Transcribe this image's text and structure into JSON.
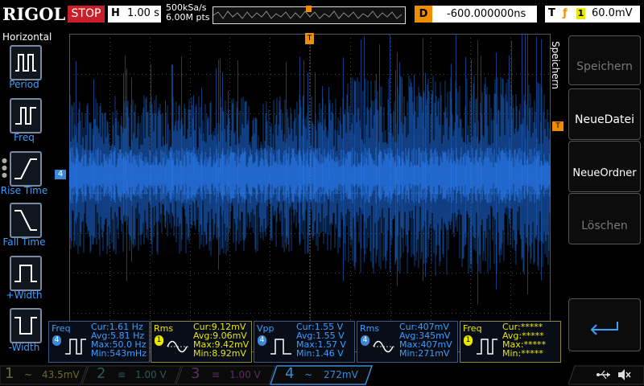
{
  "brand": "RIGOL",
  "run_state": "STOP",
  "horizontal": {
    "key": "H",
    "timebase": "1.00 s",
    "sample_rate": "500kSa/s",
    "memory": "6.00M pts"
  },
  "delay": {
    "key": "D",
    "value": "-600.000000ns"
  },
  "trigger": {
    "key": "T",
    "edge_icon": "rising-edge-icon",
    "channel": "1",
    "level": "60.0mV",
    "marker": "T"
  },
  "left_menu": {
    "title": "Horizontal",
    "items": [
      {
        "label": "Period",
        "icon": "period-icon"
      },
      {
        "label": "Freq",
        "icon": "freq-icon"
      },
      {
        "label": "Rise Time",
        "icon": "rise-time-icon"
      },
      {
        "label": "Fall Time",
        "icon": "fall-time-icon"
      },
      {
        "label": "+Width",
        "icon": "pos-width-icon"
      },
      {
        "label": "-Width",
        "icon": "neg-width-icon"
      }
    ]
  },
  "channel_marker": "4",
  "right_menu": {
    "title": "Speichern",
    "buttons": [
      {
        "label": "Speichern",
        "enabled": false
      },
      {
        "label": "NeueDatei",
        "enabled": true
      },
      {
        "label": "NeueOrdner",
        "enabled": true
      },
      {
        "label": "Löschen",
        "enabled": false
      }
    ],
    "back_icon": "return-arrow-icon"
  },
  "measurements": [
    {
      "name": "Freq",
      "channel": "4",
      "color": "#3a8ad8",
      "cur": "Cur:1.61 Hz",
      "avg": "Avg:5.81 Hz",
      "max": "Max:50.0 Hz",
      "min": "Min:543mHz"
    },
    {
      "name": "Rms",
      "channel": "1",
      "color": "#e8e800",
      "cur": "Cur:9.12mV",
      "avg": "Avg:9.06mV",
      "max": "Max:9.42mV",
      "min": "Min:8.92mV"
    },
    {
      "name": "Vpp",
      "channel": "4",
      "color": "#3a8ad8",
      "cur": "Cur:1.55 V",
      "avg": "Avg:1.55 V",
      "max": "Max:1.57 V",
      "min": "Min:1.46 V"
    },
    {
      "name": "Rms",
      "channel": "4",
      "color": "#3a8ad8",
      "cur": "Cur:407mV",
      "avg": "Avg:345mV",
      "max": "Max:407mV",
      "min": "Min:271mV"
    },
    {
      "name": "Freq",
      "channel": "1",
      "color": "#e8e800",
      "cur": "Cur:*****",
      "avg": "Avg:*****",
      "max": "Max:*****",
      "min": "Min:*****"
    }
  ],
  "channels": [
    {
      "num": "1",
      "coupling": "~",
      "scale": "43.5mV",
      "color": "#6a6a30",
      "active": false
    },
    {
      "num": "2",
      "coupling": "≡",
      "scale": "1.00 V",
      "color": "#2a5a55",
      "active": false
    },
    {
      "num": "3",
      "coupling": "≡",
      "scale": "1.00 V",
      "color": "#5a3060",
      "active": false
    },
    {
      "num": "4",
      "coupling": "~",
      "scale": "272mV",
      "color": "#3a8ad8",
      "active": true
    }
  ],
  "status_icons": [
    "usb-icon",
    "speaker-muted-icon"
  ],
  "trace_color": "#1e6ad8"
}
